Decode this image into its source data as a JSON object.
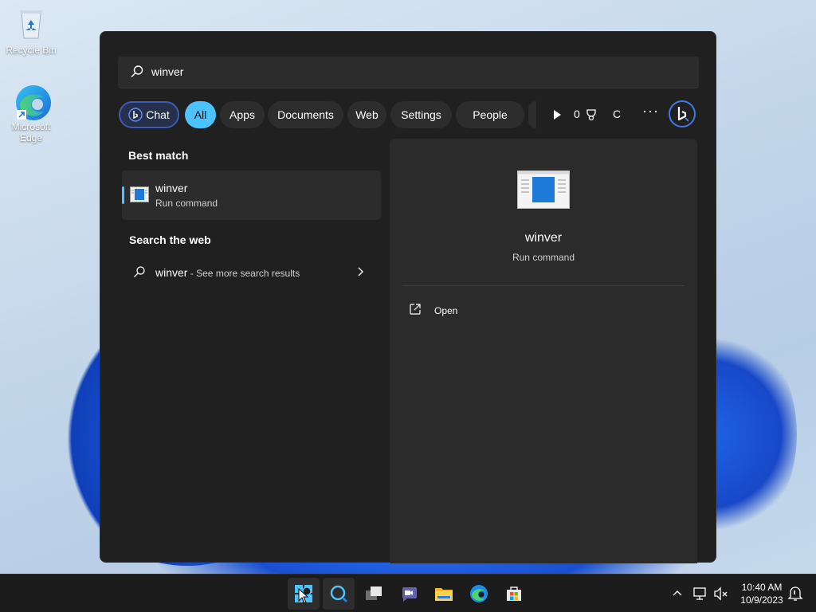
{
  "desktop": {
    "icons": [
      {
        "label": "Recycle Bin",
        "icon": "recycle-bin-icon"
      },
      {
        "label": "Microsoft Edge",
        "icon": "edge-icon"
      }
    ]
  },
  "search": {
    "query": "winver",
    "filters": {
      "chat": "Chat",
      "all": "All",
      "apps": "Apps",
      "documents": "Documents",
      "web": "Web",
      "settings": "Settings",
      "people": "People"
    },
    "points": "0",
    "avatar_initial": "C",
    "more_label": "···"
  },
  "results": {
    "best_match_heading": "Best match",
    "best_match": {
      "name": "winver",
      "type": "Run command"
    },
    "web_heading": "Search the web",
    "web_item": {
      "query": "winver",
      "more": " - See more search results"
    }
  },
  "preview": {
    "name": "winver",
    "type": "Run command",
    "actions": [
      {
        "label": "Open",
        "icon": "open-external-icon"
      }
    ]
  },
  "taskbar": {
    "items": [
      "start-icon",
      "search-icon",
      "task-view-icon",
      "chat-icon",
      "file-explorer-icon",
      "edge-icon",
      "store-icon"
    ],
    "time": "10:40 AM",
    "date": "10/9/2023"
  },
  "colors": {
    "accent": "#4cc2ff",
    "flyout_bg": "#202020",
    "taskbar_bg": "#1c1c1c"
  }
}
